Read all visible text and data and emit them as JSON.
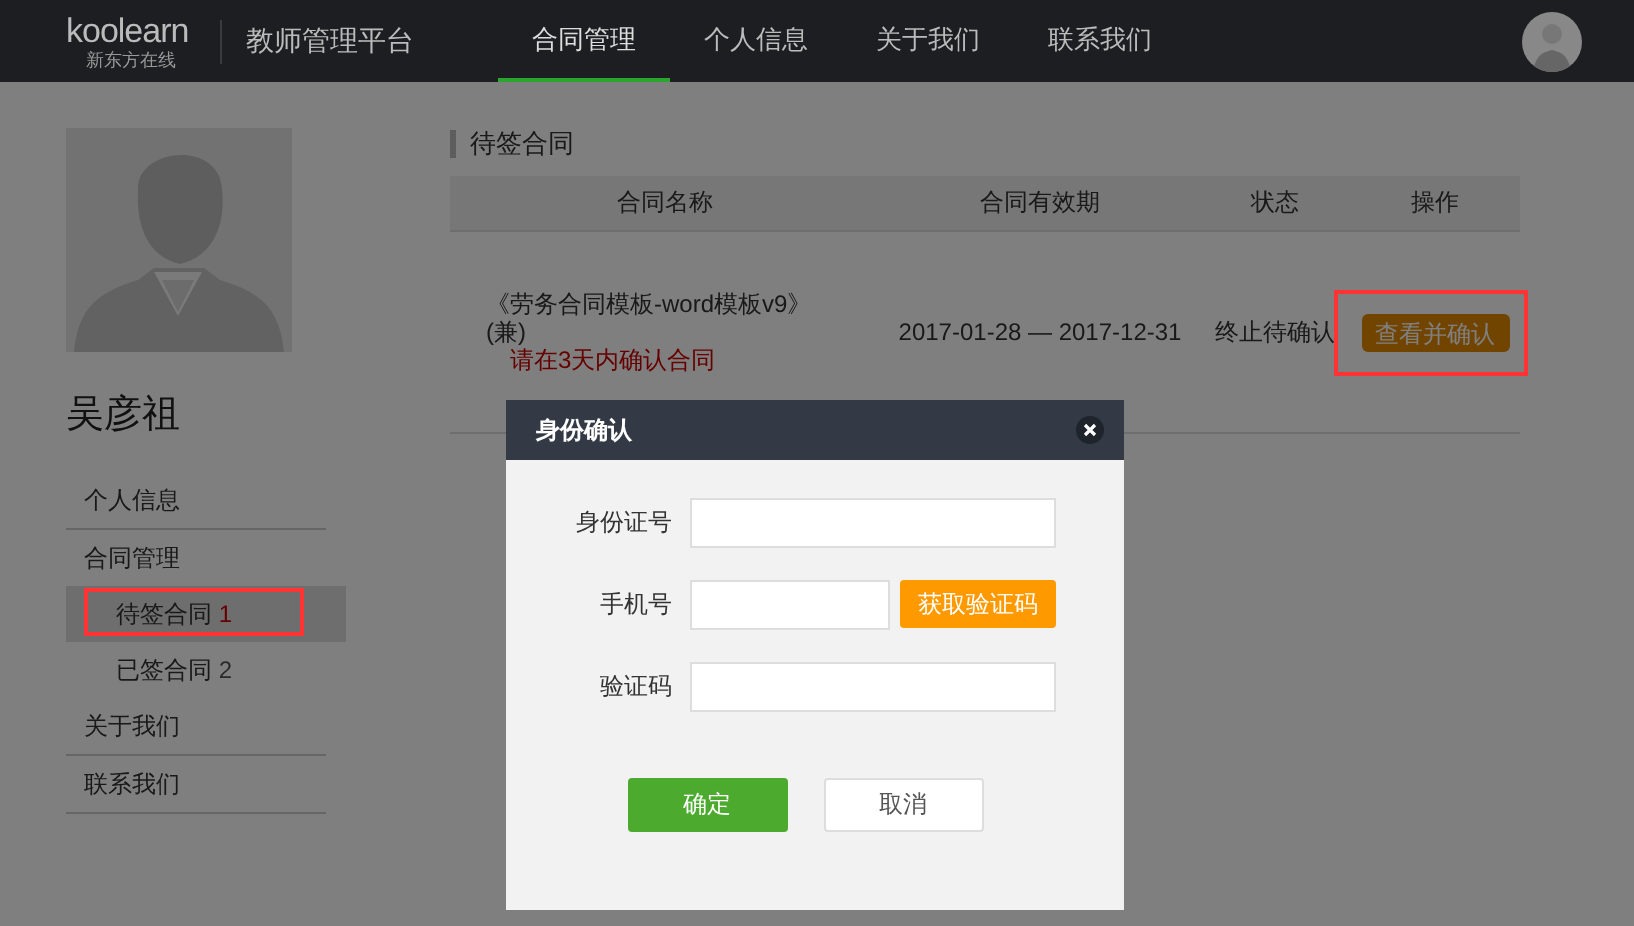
{
  "header": {
    "logo": "koolearn",
    "logo_sub": "新东方在线",
    "platform": "教师管理平台",
    "nav": [
      {
        "label": "合同管理",
        "selected": true
      },
      {
        "label": "个人信息",
        "selected": false
      },
      {
        "label": "关于我们",
        "selected": false
      },
      {
        "label": "联系我们",
        "selected": false
      }
    ]
  },
  "sidebar": {
    "name": "吴彦祖",
    "menu": [
      {
        "label": "个人信息",
        "selected": false,
        "highlighted": false
      },
      {
        "label": "合同管理",
        "selected": false,
        "highlighted": false,
        "children": [
          {
            "label": "待签合同",
            "count": "1",
            "selected": true,
            "highlighted": true
          },
          {
            "label": "已签合同",
            "count": "2",
            "selected": false,
            "highlighted": false
          }
        ]
      },
      {
        "label": "关于我们",
        "selected": false,
        "highlighted": false
      },
      {
        "label": "联系我们",
        "selected": false,
        "highlighted": false
      }
    ]
  },
  "panel": {
    "title": "待签合同",
    "columns": [
      "合同名称",
      "合同有效期",
      "状态",
      "操作"
    ],
    "rows": [
      {
        "name": "《劳务合同模板-word模板v9》(兼)",
        "notice": "请在3天内确认合同",
        "validity": "2017-01-28 — 2017-12-31",
        "status": "终止待确认",
        "action": "查看并确认",
        "highlighted": true
      }
    ]
  },
  "dialog": {
    "title": "身份确认",
    "fields": [
      {
        "label": "身份证号",
        "kind": "text"
      },
      {
        "label": "手机号",
        "kind": "code_request",
        "button": "获取验证码"
      },
      {
        "label": "验证码",
        "kind": "text"
      }
    ],
    "buttons": [
      {
        "label": "确定",
        "kind": "primary"
      },
      {
        "label": "取消",
        "kind": "secondary"
      }
    ]
  }
}
